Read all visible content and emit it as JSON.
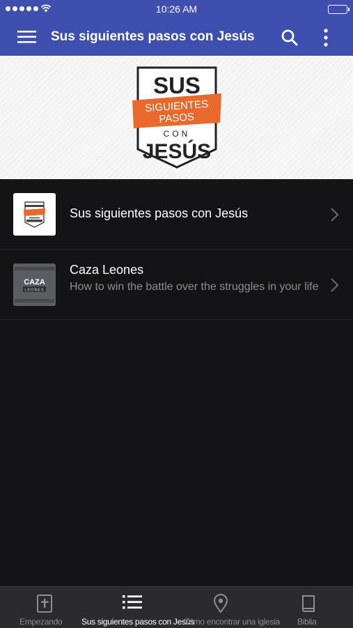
{
  "status_bar": {
    "time": "10:26 AM"
  },
  "app_bar": {
    "title": "Sus siguientes pasos con Jesús"
  },
  "banner": {
    "logo_top": "SUS",
    "logo_ribbon_1": "SIGUIENTES",
    "logo_ribbon_2": "PASOS",
    "logo_con": "CON",
    "logo_bottom": "JESÚS",
    "ribbon_color": "#e8692b"
  },
  "list": {
    "items": [
      {
        "title": "Sus siguientes pasos con Jesús",
        "subtitle": ""
      },
      {
        "title": "Caza Leones",
        "subtitle": "How to win the battle over the struggles in your life",
        "thumb_text": "CAZA",
        "thumb_subtext": "LEONES"
      }
    ]
  },
  "tab_bar": {
    "tabs": [
      {
        "label": "Empezando",
        "icon": "bible-cross-icon",
        "active": false
      },
      {
        "label": "Sus siguientes pasos con Jesús",
        "icon": "list-icon",
        "active": true
      },
      {
        "label": "Cómo encontrar una iglesia",
        "icon": "location-pin-icon",
        "active": false
      },
      {
        "label": "Biblia",
        "icon": "book-icon",
        "active": false
      }
    ]
  },
  "colors": {
    "primary": "#3f4fb0",
    "background": "#141416",
    "tab_bar": "#2b2b2e",
    "secondary_text": "#8e8e93"
  }
}
